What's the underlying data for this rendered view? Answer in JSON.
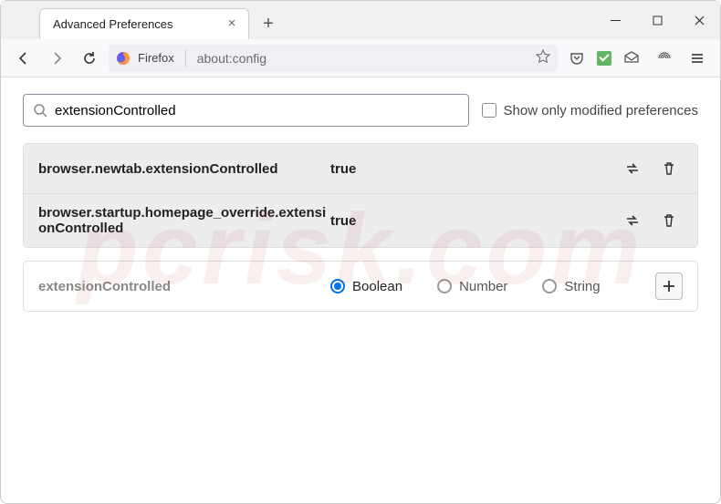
{
  "window": {
    "title": "Advanced Preferences"
  },
  "url": {
    "label": "Firefox",
    "value": "about:config"
  },
  "search": {
    "value": "extensionControlled",
    "placeholder": "",
    "checkbox_label": "Show only modified preferences"
  },
  "prefs": [
    {
      "name": "browser.newtab.extensionControlled",
      "value": "true"
    },
    {
      "name": "browser.startup.homepage_override.extensionControlled",
      "value": "true"
    }
  ],
  "new_pref": {
    "name": "extensionControlled",
    "types": [
      "Boolean",
      "Number",
      "String"
    ],
    "selected": "Boolean"
  },
  "watermark": "pcrisk.com"
}
